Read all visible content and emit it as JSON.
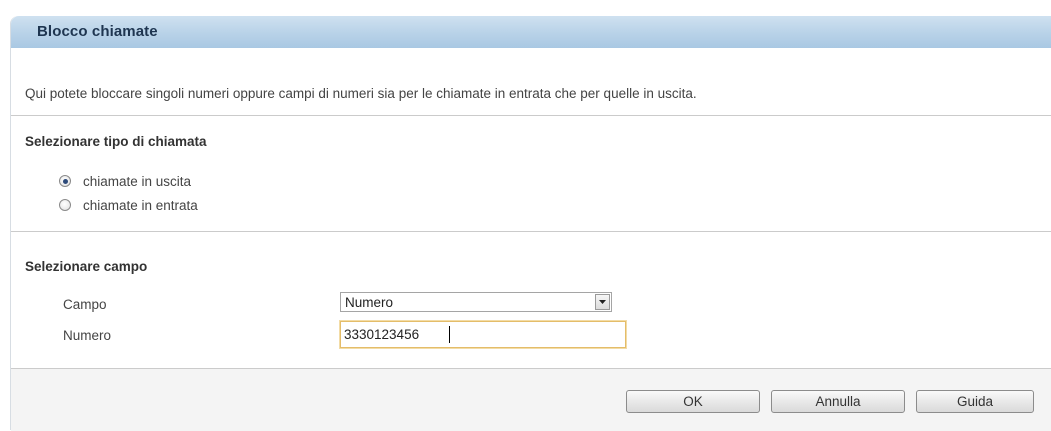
{
  "panel": {
    "title": "Blocco chiamate",
    "intro": "Qui potete bloccare singoli numeri oppure campi di numeri sia per le chiamate in entrata che per quelle in uscita."
  },
  "call_type": {
    "heading": "Selezionare tipo di chiamata",
    "options": [
      {
        "label": "chiamate in uscita",
        "selected": true
      },
      {
        "label": "chiamate in entrata",
        "selected": false
      }
    ]
  },
  "field_section": {
    "heading": "Selezionare campo",
    "campo_label": "Campo",
    "campo_value": "Numero",
    "numero_label": "Numero",
    "numero_value": "3330123456"
  },
  "buttons": {
    "ok": "OK",
    "cancel": "Annulla",
    "help": "Guida"
  }
}
